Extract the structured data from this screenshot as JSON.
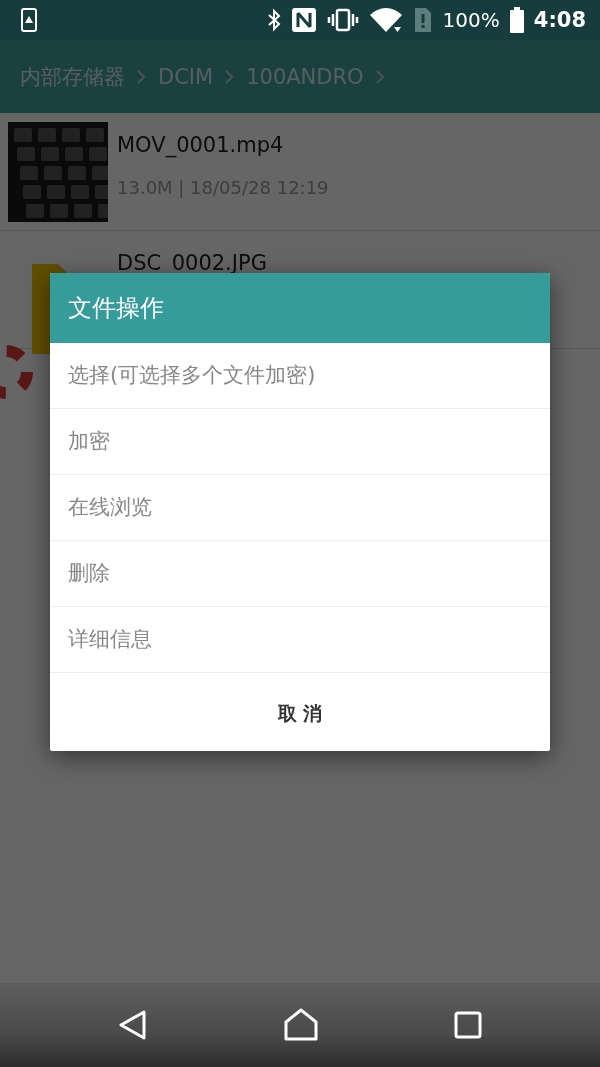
{
  "status_bar": {
    "battery_text": "100%",
    "time": "4:08"
  },
  "breadcrumb": [
    "内部存储器",
    "DCIM",
    "100ANDRO"
  ],
  "files": [
    {
      "kind": "video",
      "name": "MOV_0001.mp4",
      "meta": "13.0M | 18/05/28 12:19"
    },
    {
      "kind": "image",
      "name": "DSC_0002.JPG"
    }
  ],
  "dialog": {
    "title": "文件操作",
    "items": [
      "选择(可选择多个文件加密)",
      "加密",
      "在线浏览",
      "删除",
      "详细信息"
    ],
    "cancel": "取 消"
  }
}
